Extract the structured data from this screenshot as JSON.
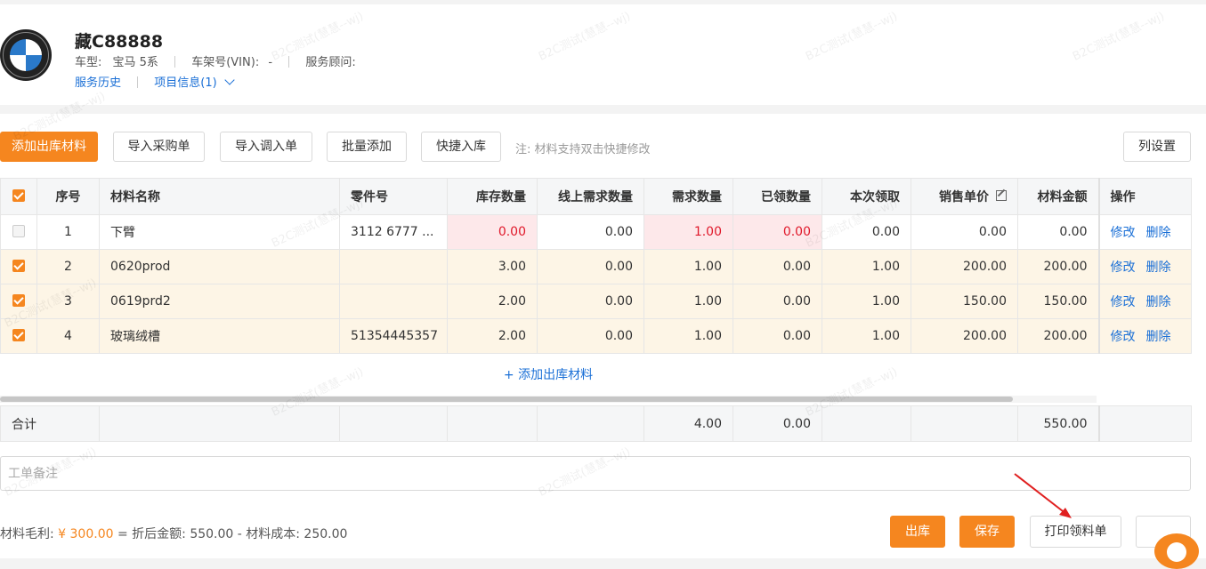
{
  "vehicle": {
    "plate": "藏C88888",
    "model_label": "车型:",
    "model_value": "宝马 5系",
    "vin_label": "车架号(VIN):",
    "vin_value": "-",
    "advisor_label": "服务顾问:",
    "advisor_value": "",
    "service_history_link": "服务历史",
    "project_info_link": "项目信息(1)"
  },
  "toolbar": {
    "add_material": "添加出库材料",
    "import_purchase": "导入采购单",
    "import_transfer": "导入调入单",
    "batch_add": "批量添加",
    "quick_stock_in": "快捷入库",
    "note": "注: 材料支持双击快捷修改",
    "column_settings": "列设置"
  },
  "table": {
    "headers": [
      "序号",
      "材料名称",
      "零件号",
      "库存数量",
      "线上需求数量",
      "需求数量",
      "已领数量",
      "本次领取",
      "销售单价",
      "材料金额",
      "操作"
    ],
    "rows": [
      {
        "checked": false,
        "no": "1",
        "name": "下臂",
        "part_no": "3112 6777 ...",
        "stock": "0.00",
        "online_demand": "0.00",
        "demand": "1.00",
        "received": "0.00",
        "this_time": "0.00",
        "unit_price": "0.00",
        "amount": "0.00",
        "edit": "修改",
        "delete": "删除"
      },
      {
        "checked": true,
        "no": "2",
        "name": "0620prod",
        "part_no": "",
        "stock": "3.00",
        "online_demand": "0.00",
        "demand": "1.00",
        "received": "0.00",
        "this_time": "1.00",
        "unit_price": "200.00",
        "amount": "200.00",
        "edit": "修改",
        "delete": "删除"
      },
      {
        "checked": true,
        "no": "3",
        "name": "0619prd2",
        "part_no": "",
        "stock": "2.00",
        "online_demand": "0.00",
        "demand": "1.00",
        "received": "0.00",
        "this_time": "1.00",
        "unit_price": "150.00",
        "amount": "150.00",
        "edit": "修改",
        "delete": "删除"
      },
      {
        "checked": true,
        "no": "4",
        "name": "玻璃绒槽",
        "part_no": "51354445357",
        "stock": "2.00",
        "online_demand": "0.00",
        "demand": "1.00",
        "received": "0.00",
        "this_time": "1.00",
        "unit_price": "200.00",
        "amount": "200.00",
        "edit": "修改",
        "delete": "删除"
      }
    ],
    "add_row_link": "+ 添加出库材料",
    "summary_label": "合计",
    "summary_demand": "4.00",
    "summary_received": "0.00",
    "summary_amount": "550.00"
  },
  "remark": {
    "placeholder": "工单备注"
  },
  "footer": {
    "profit_label": "材料毛利:",
    "profit_amount": "¥ 300.00",
    "formula": "= 折后金额: 550.00 - 材料成本: 250.00",
    "out_button": "出库",
    "save_button": "保存",
    "print_button": "打印领料单"
  },
  "watermark": "B2C测试(慧慧--wj)",
  "colors": {
    "accent": "#f5861f",
    "link": "#1a6fd6",
    "error": "#e0192b",
    "annotation_arrow": "#e02020"
  }
}
